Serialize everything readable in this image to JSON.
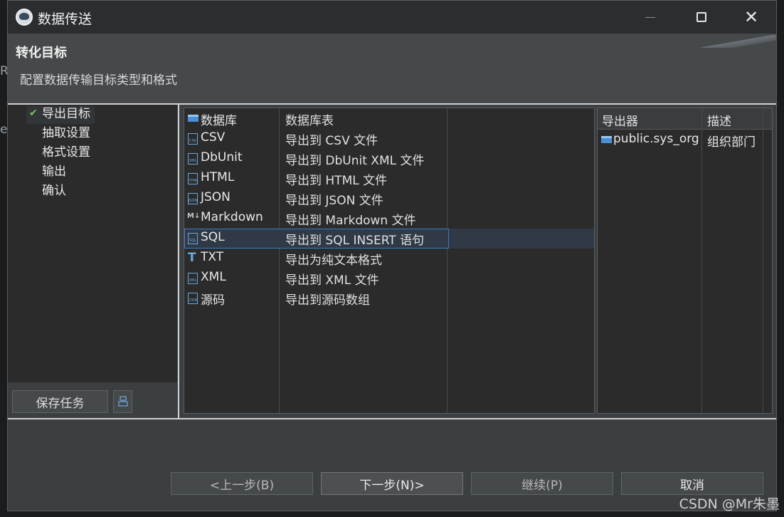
{
  "window": {
    "title": "数据传送"
  },
  "header": {
    "title": "转化目标",
    "subtitle": "配置数据传输目标类型和格式"
  },
  "background_fragments": [
    "Ro",
    "e"
  ],
  "nav": {
    "items": [
      {
        "label": "导出目标",
        "checked": true
      },
      {
        "label": "抽取设置"
      },
      {
        "label": "格式设置"
      },
      {
        "label": "输出"
      },
      {
        "label": "确认"
      }
    ],
    "save_task_label": "保存任务"
  },
  "exporters": [
    {
      "name": "数据库",
      "desc": "数据库表",
      "icon": "database-icon"
    },
    {
      "name": "CSV",
      "desc": "导出到 CSV 文件",
      "icon": "csv-file-icon",
      "tag": "CSV"
    },
    {
      "name": "DbUnit",
      "desc": "导出到 DbUnit XML 文件",
      "icon": "xml-file-icon",
      "tag": "XML"
    },
    {
      "name": "HTML",
      "desc": "导出到 HTML 文件",
      "icon": "html-file-icon",
      "tag": "HTML"
    },
    {
      "name": "JSON",
      "desc": "导出到 JSON 文件",
      "icon": "json-file-icon",
      "tag": "JSON"
    },
    {
      "name": "Markdown",
      "desc": "导出到 Markdown 文件",
      "icon": "markdown-icon",
      "tag": "M↓"
    },
    {
      "name": "SQL",
      "desc": "导出到 SQL INSERT 语句",
      "icon": "sql-file-icon",
      "tag": "SQL",
      "selected": true
    },
    {
      "name": "TXT",
      "desc": "导出为纯文本格式",
      "icon": "text-icon",
      "tag": "T"
    },
    {
      "name": "XML",
      "desc": "导出到 XML 文件",
      "icon": "xml-file-icon",
      "tag": "XML"
    },
    {
      "name": "源码",
      "desc": "导出到源码数组",
      "icon": "code-file-icon",
      "tag": "CODE"
    }
  ],
  "exporter_table": {
    "headers": [
      "导出器",
      "描述"
    ],
    "rows": [
      {
        "exporter": "public.sys_org",
        "desc": "组织部门"
      }
    ]
  },
  "buttons": {
    "back": "<上一步(B)",
    "next": "下一步(N)>",
    "continue": "继续(P)",
    "cancel": "取消"
  },
  "watermark": "CSDN @Mr朱墨",
  "colors": {
    "accent": "#3b7bbf",
    "check": "#7ec26a",
    "background": "#3c3f41"
  }
}
